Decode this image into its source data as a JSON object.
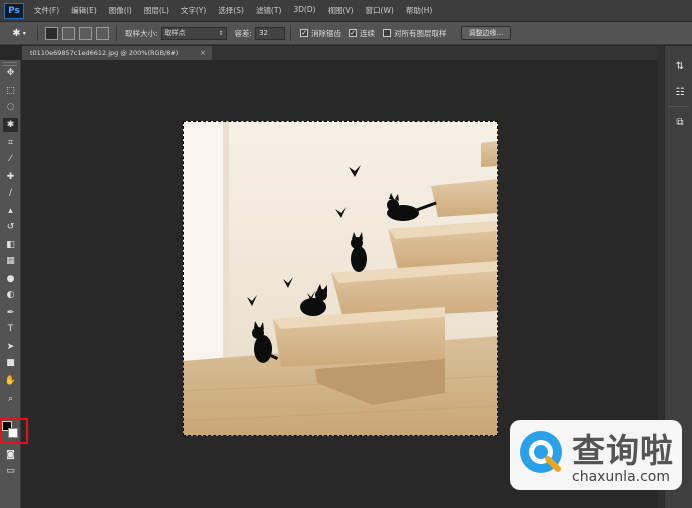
{
  "app": {
    "logo": "Ps"
  },
  "menu": [
    "文件(F)",
    "编辑(E)",
    "图像(I)",
    "图层(L)",
    "文字(Y)",
    "选择(S)",
    "滤镜(T)",
    "3D(D)",
    "视图(V)",
    "窗口(W)",
    "帮助(H)"
  ],
  "options": {
    "sample_size_label": "取样大小:",
    "sample_size_value": "取样点",
    "tolerance_label": "容差:",
    "tolerance_value": "32",
    "antialias_label": "消除锯齿",
    "contiguous_label": "连续",
    "all_layers_label": "对所有图层取样",
    "refine_edge_button": "调整边缘...",
    "antialias_checked": true,
    "contiguous_checked": true,
    "all_layers_checked": false
  },
  "document": {
    "tab_title": "t0110e69857c1ed6612.jpg @ 200%(RGB/8#)",
    "close_symbol": "×"
  },
  "toolbar": {
    "tools": [
      {
        "name": "move-tool",
        "icon": "move-icon",
        "glyph": "✥"
      },
      {
        "name": "marquee-tool",
        "icon": "rect-marquee-icon",
        "glyph": "⬚"
      },
      {
        "name": "lasso-tool",
        "icon": "lasso-icon",
        "glyph": "◌"
      },
      {
        "name": "magic-wand-tool",
        "icon": "magic-wand-icon",
        "glyph": "✱",
        "active": true
      },
      {
        "name": "crop-tool",
        "icon": "crop-icon",
        "glyph": "⌗"
      },
      {
        "name": "eyedropper-tool",
        "icon": "eyedropper-icon",
        "glyph": "⁄"
      },
      {
        "name": "healing-tool",
        "icon": "bandage-icon",
        "glyph": "✚"
      },
      {
        "name": "brush-tool",
        "icon": "brush-icon",
        "glyph": "∕"
      },
      {
        "name": "stamp-tool",
        "icon": "stamp-icon",
        "glyph": "▴"
      },
      {
        "name": "history-brush-tool",
        "icon": "history-brush-icon",
        "glyph": "↺"
      },
      {
        "name": "eraser-tool",
        "icon": "eraser-icon",
        "glyph": "◧"
      },
      {
        "name": "gradient-tool",
        "icon": "gradient-icon",
        "glyph": "▦"
      },
      {
        "name": "blur-tool",
        "icon": "drop-icon",
        "glyph": "●"
      },
      {
        "name": "dodge-tool",
        "icon": "dodge-icon",
        "glyph": "◐"
      },
      {
        "name": "pen-tool",
        "icon": "pen-icon",
        "glyph": "✒"
      },
      {
        "name": "type-tool",
        "icon": "type-icon",
        "glyph": "T"
      },
      {
        "name": "path-select-tool",
        "icon": "arrow-icon",
        "glyph": "➤"
      },
      {
        "name": "shape-tool",
        "icon": "rectangle-icon",
        "glyph": "■"
      },
      {
        "name": "hand-tool",
        "icon": "hand-icon",
        "glyph": "✋"
      },
      {
        "name": "zoom-tool",
        "icon": "zoom-icon",
        "glyph": "⌕"
      }
    ],
    "foreground_color": "#000000",
    "background_color": "#ffffff"
  },
  "dock": [
    {
      "name": "dock-history",
      "icon": "history-panel-icon",
      "glyph": "⇅"
    },
    {
      "name": "dock-adjust",
      "icon": "properties-panel-icon",
      "glyph": "☷"
    },
    {
      "name": "dock-layers",
      "icon": "layers-panel-icon",
      "glyph": "⧉"
    }
  ],
  "watermark": {
    "cn": "查询啦",
    "en": "chaxunla.com"
  },
  "colors": {
    "accent_red": "#e0141e",
    "wood": "#d7bf9c",
    "wall": "#f6f0e6"
  }
}
